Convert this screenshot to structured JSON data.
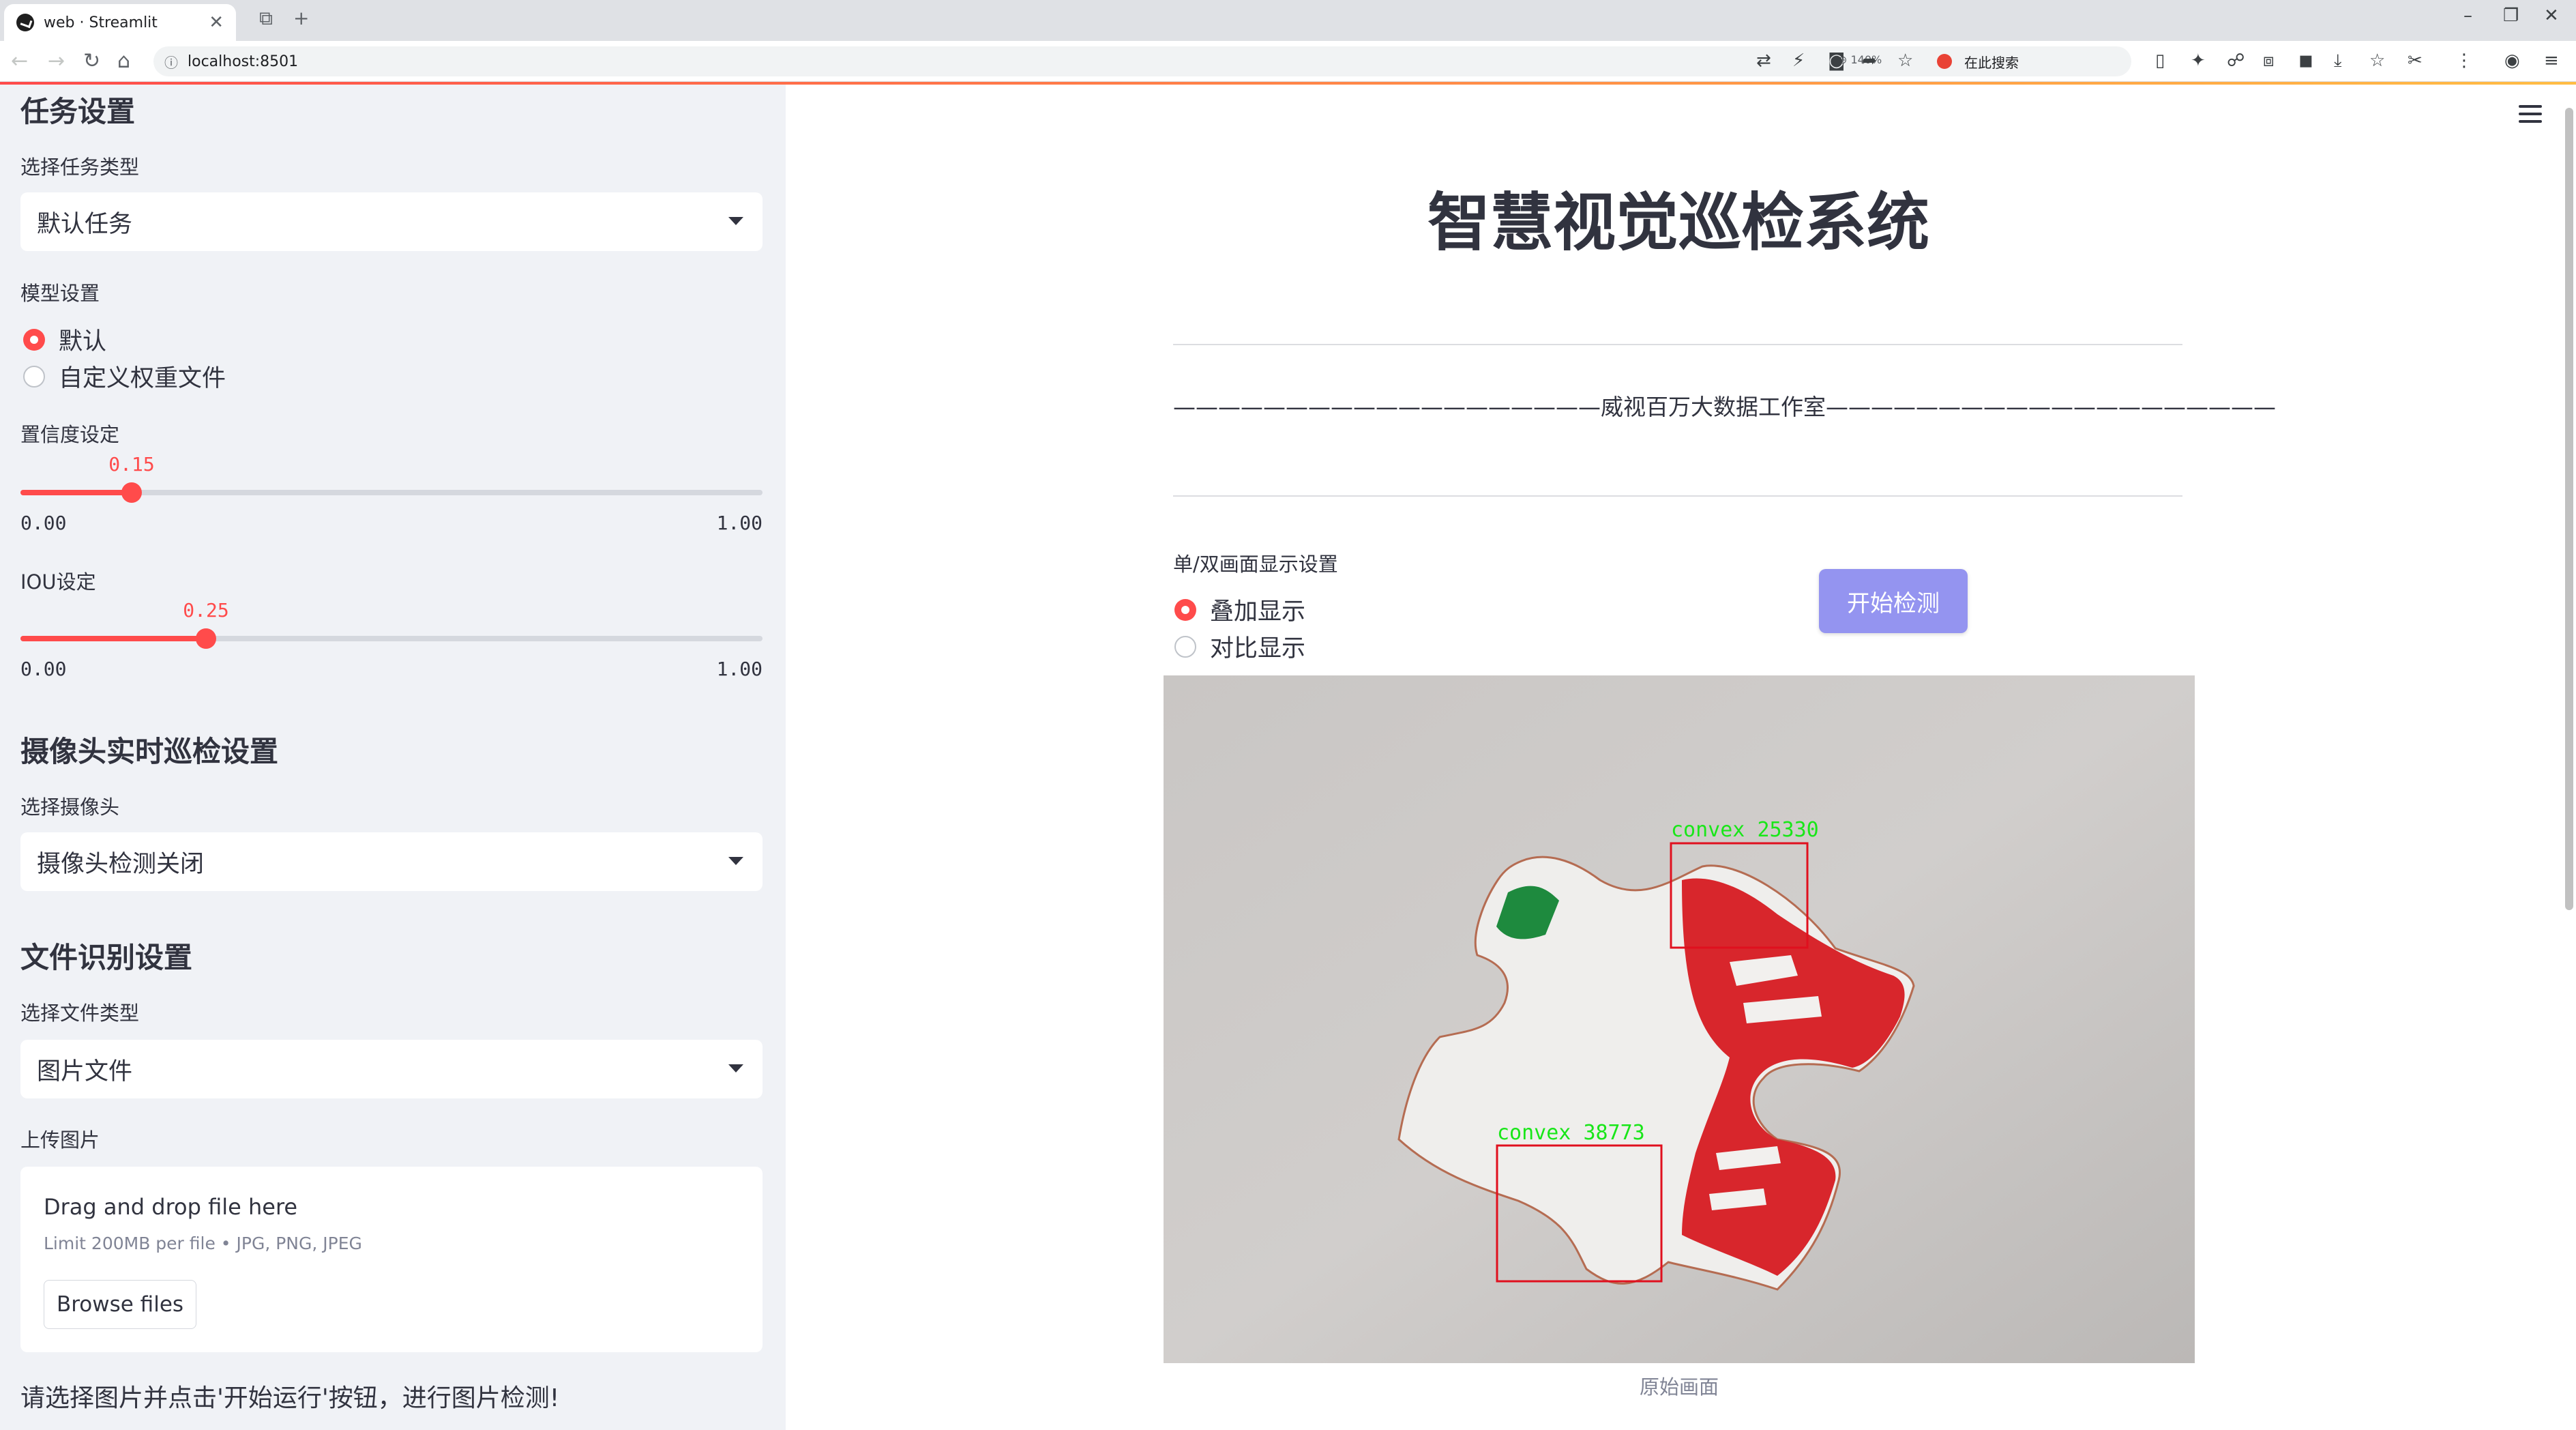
{
  "browser": {
    "tab_title": "web · Streamlit",
    "url": "localhost:8501",
    "zoom": "140%",
    "search_placeholder": "在此搜索"
  },
  "sidebar": {
    "task_heading": "任务设置",
    "task_type_label": "选择任务类型",
    "task_type_value": "默认任务",
    "model_label": "模型设置",
    "model_options": [
      "默认",
      "自定义权重文件"
    ],
    "model_selected": "默认",
    "confidence": {
      "label": "置信度设定",
      "value": "0.15",
      "min": "0.00",
      "max": "1.00",
      "fraction": 0.15
    },
    "iou": {
      "label": "IOU设定",
      "value": "0.25",
      "min": "0.00",
      "max": "1.00",
      "fraction": 0.25
    },
    "camera_heading": "摄像头实时巡检设置",
    "camera_label": "选择摄像头",
    "camera_value": "摄像头检测关闭",
    "file_heading": "文件识别设置",
    "file_type_label": "选择文件类型",
    "file_type_value": "图片文件",
    "upload_label": "上传图片",
    "uploader": {
      "title": "Drag and drop file here",
      "limit": "Limit 200MB per file • JPG, PNG, JPEG",
      "button": "Browse files"
    },
    "info": "请选择图片并点击'开始运行'按钮，进行图片检测!"
  },
  "main": {
    "title": "智慧视觉巡检系统",
    "studio_line": "———————————————————威视百万大数据工作室————————————————————",
    "display_label": "单/双画面显示设置",
    "display_options": [
      "叠加显示",
      "对比显示"
    ],
    "display_selected": "叠加显示",
    "start_button": "开始检测",
    "caption": "原始画面",
    "detections": [
      {
        "label": "convex",
        "score": "25330"
      },
      {
        "label": "convex",
        "score": "38773"
      }
    ],
    "colors": {
      "accent": "#ff4b4b",
      "button": "#9494f0",
      "box": "#e0101e",
      "box_label": "#19e619"
    }
  }
}
